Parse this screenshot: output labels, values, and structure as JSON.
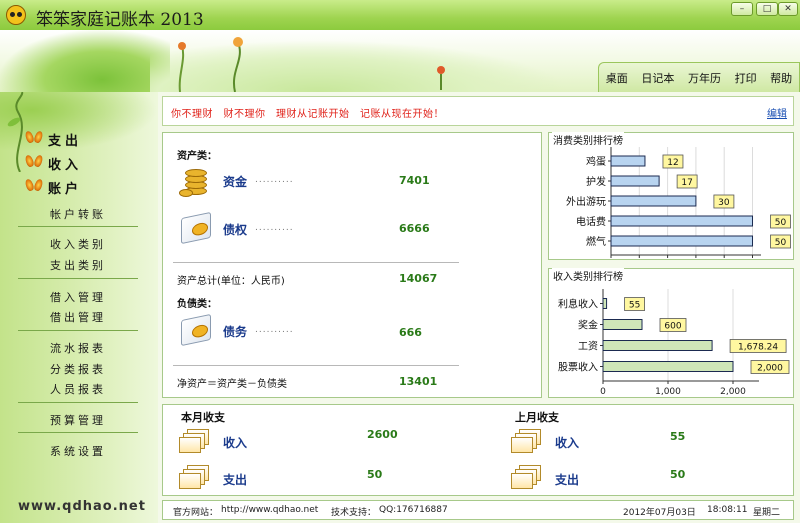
{
  "window": {
    "title": "笨笨家庭记账本 2013"
  },
  "top_nav": [
    "桌面",
    "日记本",
    "万年历",
    "打印",
    "帮助"
  ],
  "sidebar": {
    "main": [
      "支出",
      "收入",
      "账户"
    ],
    "groups": [
      [
        "帐户转账"
      ],
      [
        "收入类别",
        "支出类别"
      ],
      [
        "借入管理",
        "借出管理"
      ],
      [
        "流水报表",
        "分类报表",
        "人员报表"
      ],
      [
        "预算管理"
      ],
      [
        "系统设置"
      ]
    ],
    "site": "www.qdhao.net"
  },
  "message": {
    "text": "你不理财　财不理你　理财从记账开始　记账从现在开始！",
    "edit": "编辑"
  },
  "assets": {
    "asset_heading": "资产类：",
    "accounts": [
      {
        "name": "资金",
        "value": "7401"
      },
      {
        "name": "债权",
        "value": "6666"
      }
    ],
    "asset_total_label": "资产总计(单位：人民币)",
    "asset_total": "14067",
    "liability_heading": "负债类：",
    "liabilities": [
      {
        "name": "债务",
        "value": "666"
      }
    ],
    "net_label": "净资产＝资产类－负债类",
    "net": "13401",
    "dots": "..........",
    "dots_long": "............"
  },
  "monthly": {
    "this_month": {
      "heading": "本月收支",
      "income_label": "收入",
      "income": "2600",
      "expense_label": "支出",
      "expense": "50"
    },
    "last_month": {
      "heading": "上月收支",
      "income_label": "收入",
      "income": "55",
      "expense_label": "支出",
      "expense": "50"
    }
  },
  "status": {
    "website_label": "官方网站：",
    "website": "http://www.qdhao.net",
    "support_label": "技术支持：",
    "support": "QQ:176716887",
    "date": "2012年07月03日",
    "time": "18:08:11",
    "weekday": "星期二"
  },
  "colors": {
    "bar_fill": "#b8d4f0",
    "bar_stroke": "#1b2a50",
    "inc_fill": "#cfe6b8",
    "label_bg": "#fff7a0",
    "value_green": "#2a7a18",
    "name_blue": "#1b3b8c",
    "message_red": "#e0231b"
  },
  "chart_data": [
    {
      "type": "bar",
      "orientation": "horizontal",
      "title": "消费类别排行榜",
      "categories": [
        "鸡蛋",
        "护发",
        "外出游玩",
        "电话费",
        "燃气"
      ],
      "values": [
        12,
        17,
        30,
        50,
        50
      ],
      "value_labels": [
        "12",
        "17",
        "30",
        "50",
        "50"
      ],
      "xlim": [
        0,
        53
      ],
      "xticks": [
        0,
        10,
        20,
        30,
        40,
        50
      ],
      "xtick_labels": [
        "0",
        "10",
        "20",
        "30",
        "40",
        "50"
      ]
    },
    {
      "type": "bar",
      "orientation": "horizontal",
      "title": "收入类别排行榜",
      "categories": [
        "利息收入",
        "奖金",
        "工资",
        "股票收入"
      ],
      "values": [
        55,
        600,
        1678.24,
        2000
      ],
      "value_labels": [
        "55",
        "600",
        "1,678.24",
        "2,000"
      ],
      "xlim": [
        0,
        2400
      ],
      "xticks": [
        0,
        1000,
        2000
      ],
      "xtick_labels": [
        "0",
        "1,000",
        "2,000"
      ]
    }
  ]
}
